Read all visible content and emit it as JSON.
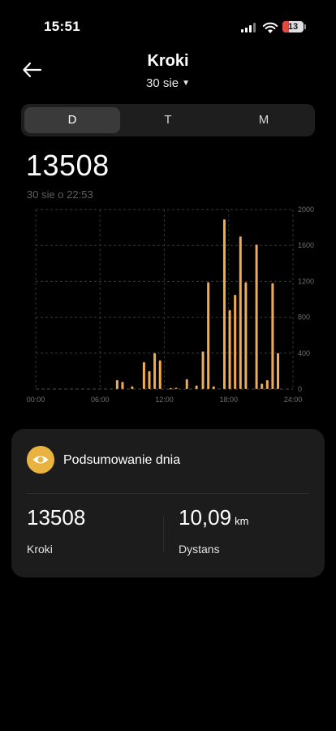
{
  "status_bar": {
    "time": "15:51",
    "battery_level": "13"
  },
  "header": {
    "title": "Kroki",
    "date": "30 sie"
  },
  "tabs": [
    {
      "label": "D",
      "active": true
    },
    {
      "label": "T",
      "active": false
    },
    {
      "label": "M",
      "active": false
    }
  ],
  "summary_value": "13508",
  "summary_time": "30 sie o 22:53",
  "chart_data": {
    "type": "bar",
    "x_range": [
      0,
      24
    ],
    "x_ticks": [
      "00:00",
      "06:00",
      "12:00",
      "18:00",
      "24:00"
    ],
    "y_ticks": [
      "0",
      "400",
      "800",
      "1200",
      "1600",
      "2000"
    ],
    "ylim": [
      0,
      2000
    ],
    "grid": true,
    "color": "#f0ab55",
    "bars": [
      {
        "hour": 7.6,
        "value": 100
      },
      {
        "hour": 8.1,
        "value": 80
      },
      {
        "hour": 9.0,
        "value": 30
      },
      {
        "hour": 10.1,
        "value": 300
      },
      {
        "hour": 10.6,
        "value": 200
      },
      {
        "hour": 11.1,
        "value": 400
      },
      {
        "hour": 11.6,
        "value": 320
      },
      {
        "hour": 12.6,
        "value": 10
      },
      {
        "hour": 13.1,
        "value": 15
      },
      {
        "hour": 14.1,
        "value": 110
      },
      {
        "hour": 15.0,
        "value": 40
      },
      {
        "hour": 15.6,
        "value": 420
      },
      {
        "hour": 16.1,
        "value": 1190
      },
      {
        "hour": 16.6,
        "value": 30
      },
      {
        "hour": 17.6,
        "value": 1890
      },
      {
        "hour": 18.1,
        "value": 880
      },
      {
        "hour": 18.6,
        "value": 1050
      },
      {
        "hour": 19.1,
        "value": 1700
      },
      {
        "hour": 19.6,
        "value": 1190
      },
      {
        "hour": 20.6,
        "value": 1610
      },
      {
        "hour": 21.1,
        "value": 60
      },
      {
        "hour": 21.6,
        "value": 100
      },
      {
        "hour": 22.1,
        "value": 1180
      },
      {
        "hour": 22.6,
        "value": 400
      }
    ]
  },
  "card": {
    "title": "Podsumowanie dnia",
    "steps_value": "13508",
    "steps_label": "Kroki",
    "distance_value": "10,09",
    "distance_unit": "km",
    "distance_label": "Dystans"
  },
  "colors": {
    "accent": "#e9b33f",
    "bar": "#f0ab55",
    "card": "#1c1c1c"
  }
}
